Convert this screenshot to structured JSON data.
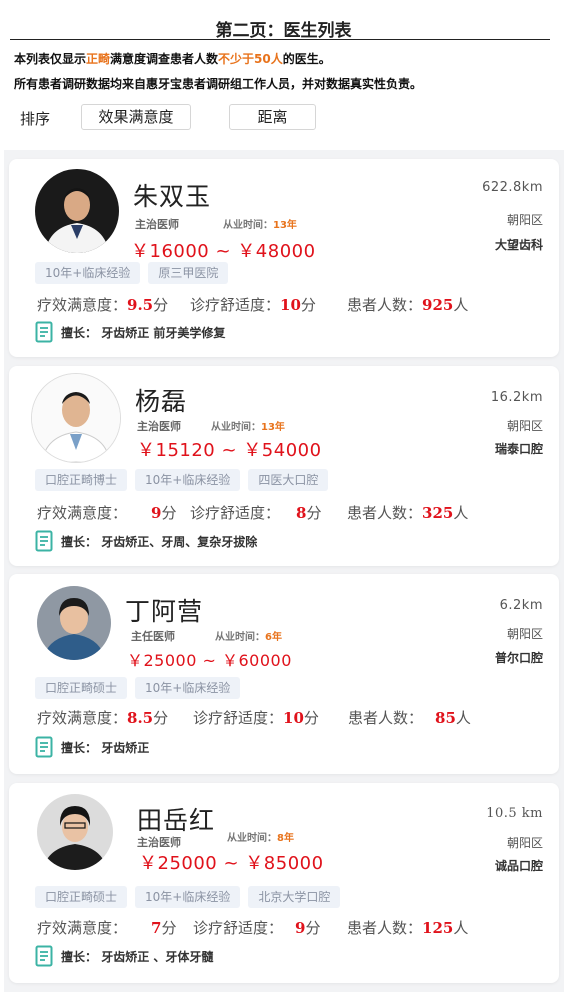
{
  "page": {
    "title": "第二页：医生列表",
    "note1": {
      "a": "本列表仅显示",
      "b": "正畸",
      "c": "满意度调查患者人数",
      "d": "不少于50人",
      "e": "的医生。"
    },
    "note2": "所有患者调研数据均来自惠牙宝患者调研组工作人员，并对数据真实性负责。"
  },
  "sort": {
    "label": "排序",
    "options": [
      "效果满意度",
      "距离"
    ]
  },
  "labels": {
    "exp": "从业时间：",
    "satisfaction": "疗效满意度：",
    "comfort": "诊疗舒适度：",
    "patients": "患者人数：",
    "score_unit": "分",
    "people_unit": "人",
    "specialty": "擅长："
  },
  "doctors": [
    {
      "name": "朱双玉",
      "role": "主治医师",
      "exp": "13年",
      "price": "￥16000 ~ ￥48000",
      "distance": "622.8km",
      "area": "朝阳区",
      "clinic": "大望齿科",
      "tags": [
        "10年+临床经验",
        "原三甲医院"
      ],
      "satisfaction": "9.5",
      "comfort": "10",
      "patients": "925",
      "specialty": "牙齿矫正  前牙美学修复"
    },
    {
      "name": "杨磊",
      "role": "主治医师",
      "exp": "13年",
      "price": "￥15120 ~ ￥54000",
      "distance": "16.2km",
      "area": "朝阳区",
      "clinic": "瑞泰口腔",
      "tags": [
        "口腔正畸博士",
        "10年+临床经验",
        "四医大口腔"
      ],
      "satisfaction": "9",
      "comfort": "8",
      "patients": "325",
      "specialty": "牙齿矫正、牙周、复杂牙拔除"
    },
    {
      "name": "丁阿营",
      "role": "主任医师",
      "exp": "6年",
      "price": "￥25000 ~ ￥60000",
      "distance": "6.2km",
      "area": "朝阳区",
      "clinic": "普尔口腔",
      "tags": [
        "口腔正畸硕士",
        "10年+临床经验"
      ],
      "satisfaction": "8.5",
      "comfort": "10",
      "patients": "85",
      "specialty": "牙齿矫正"
    },
    {
      "name": "田岳红",
      "role": "主治医师",
      "exp": "8年",
      "price": "￥25000 ~ ￥85000",
      "distance": "10.5 km",
      "area": "朝阳区",
      "clinic": "诚品口腔",
      "tags": [
        "口腔正畸硕士",
        "10年+临床经验",
        "北京大学口腔"
      ],
      "satisfaction": "7",
      "comfort": "9",
      "patients": "125",
      "specialty": "牙齿矫正 、牙体牙髓"
    }
  ],
  "colors": {
    "accent": "#e8731c",
    "price": "#e0121b",
    "icon": "#3bb3a4"
  }
}
